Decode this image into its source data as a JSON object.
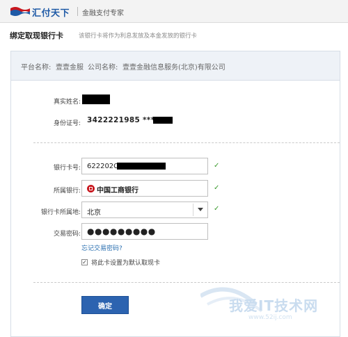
{
  "header": {
    "logo_text": "汇付天下",
    "slogan": "金融支付专家"
  },
  "page": {
    "title": "绑定取现银行卡",
    "note": "该银行卡将作为利息发放及本金发放的银行卡"
  },
  "platform_bar": {
    "platform_label": "平台名称:",
    "platform_value": "壹壹金服",
    "company_label": "公司名称:",
    "company_value": "壹壹金融信息服务(北京)有限公司"
  },
  "identity": {
    "name_label": "真实姓名:",
    "id_label": "身份证号:",
    "id_value": "3422221985 ****"
  },
  "form": {
    "card_label": "银行卡号:",
    "card_value": "622202C",
    "bank_label": "所属银行:",
    "bank_value": "中国工商银行",
    "region_label": "银行卡所属地:",
    "region_value": "北京",
    "password_label": "交易密码:",
    "password_value": "●●●●●●●●●",
    "check_mark": "✓",
    "forgot_password": "忘记交易密码?",
    "default_checkbox_checked": true,
    "default_checkbox_label": "将此卡设置为默认取现卡",
    "submit_label": "确定"
  },
  "watermark": {
    "text": "我爱IT技术网",
    "url": "www.52ij.com"
  },
  "colors": {
    "brand_blue": "#1f5aa6",
    "button_blue": "#2c63b0",
    "check_green": "#3a9a2c",
    "link_blue": "#2a6fb0",
    "panel_header_bg": "#eef2f7",
    "bank_red": "#c8161d"
  },
  "icons": {
    "logo": "flag-logo-icon",
    "bank": "icbc-bank-icon",
    "select": "chevron-down-icon",
    "valid": "check-icon"
  }
}
